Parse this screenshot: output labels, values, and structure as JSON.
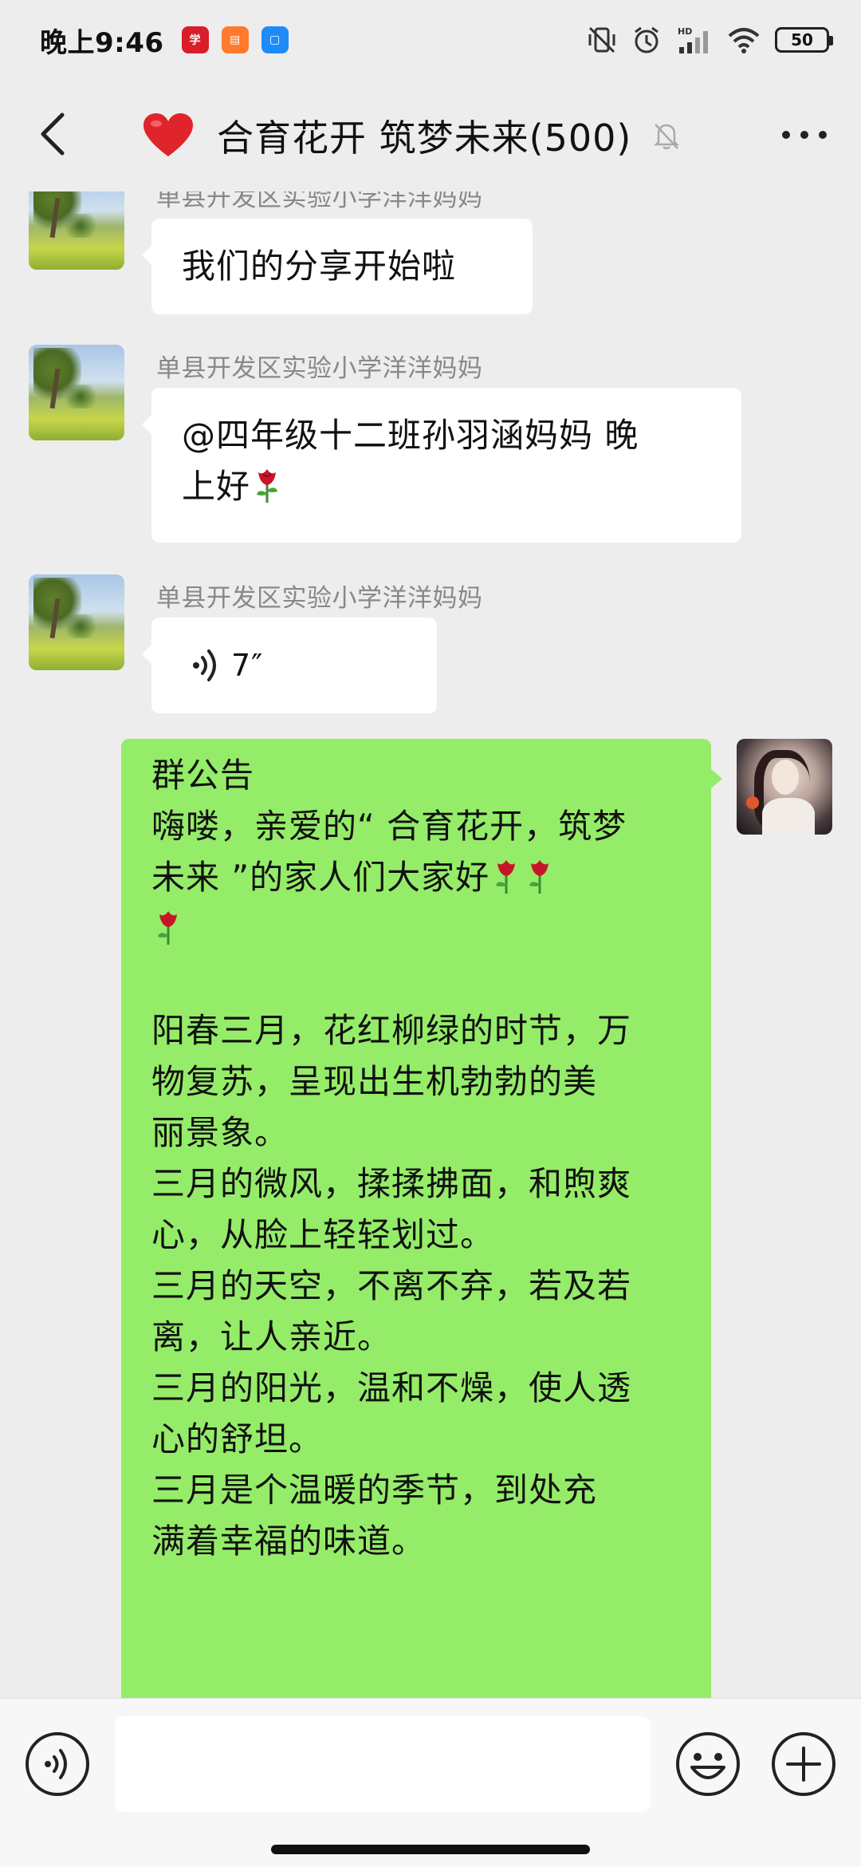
{
  "status_bar": {
    "time": "晚上9:46",
    "app_icons": [
      "red-app-icon",
      "orange-app-icon",
      "blue-app-icon"
    ],
    "battery": "50"
  },
  "header": {
    "title": "合育花开 筑梦未来(500)",
    "back_icon": "chevron-left-icon",
    "heart_icon": "heart-icon",
    "mute_icon": "bell-muted-icon",
    "more_icon": "more-dots-icon"
  },
  "messages": [
    {
      "sender": "单县开发区实验小学洋洋妈妈",
      "text": "我们的分享开始啦"
    },
    {
      "sender": "单县开发区实验小学洋洋妈妈",
      "text_line1": "@四年级十二班孙羽涵妈妈  晚",
      "text_line2": "上好"
    },
    {
      "sender": "单县开发区实验小学洋洋妈妈",
      "voice_duration": "7″"
    }
  ],
  "announcement": {
    "title": "群公告",
    "lines": [
      "嗨喽，亲爱的“ 合育花开，筑梦",
      "未来 ”的家人们大家好",
      "",
      "",
      "阳春三月，花红柳绿的时节，万",
      "物复苏，呈现出生机勃勃的美",
      "丽景象。",
      "三月的微风，揉揉拂面，和煦爽",
      "心，从脸上轻轻划过。",
      "三月的天空，不离不弃，若及若",
      "离，让人亲近。",
      "三月的阳光，温和不燥，使人透",
      "心的舒坦。",
      "三月是个温暖的季节，到处充",
      "满着幸福的味道。"
    ]
  },
  "input_bar": {
    "voice_icon": "voice-icon",
    "emoji_icon": "emoji-icon",
    "plus_icon": "plus-icon",
    "placeholder": ""
  },
  "colors": {
    "background": "#ededed",
    "incoming_bubble": "#ffffff",
    "outgoing_bubble": "#95ec69",
    "sender_text": "#888888"
  }
}
